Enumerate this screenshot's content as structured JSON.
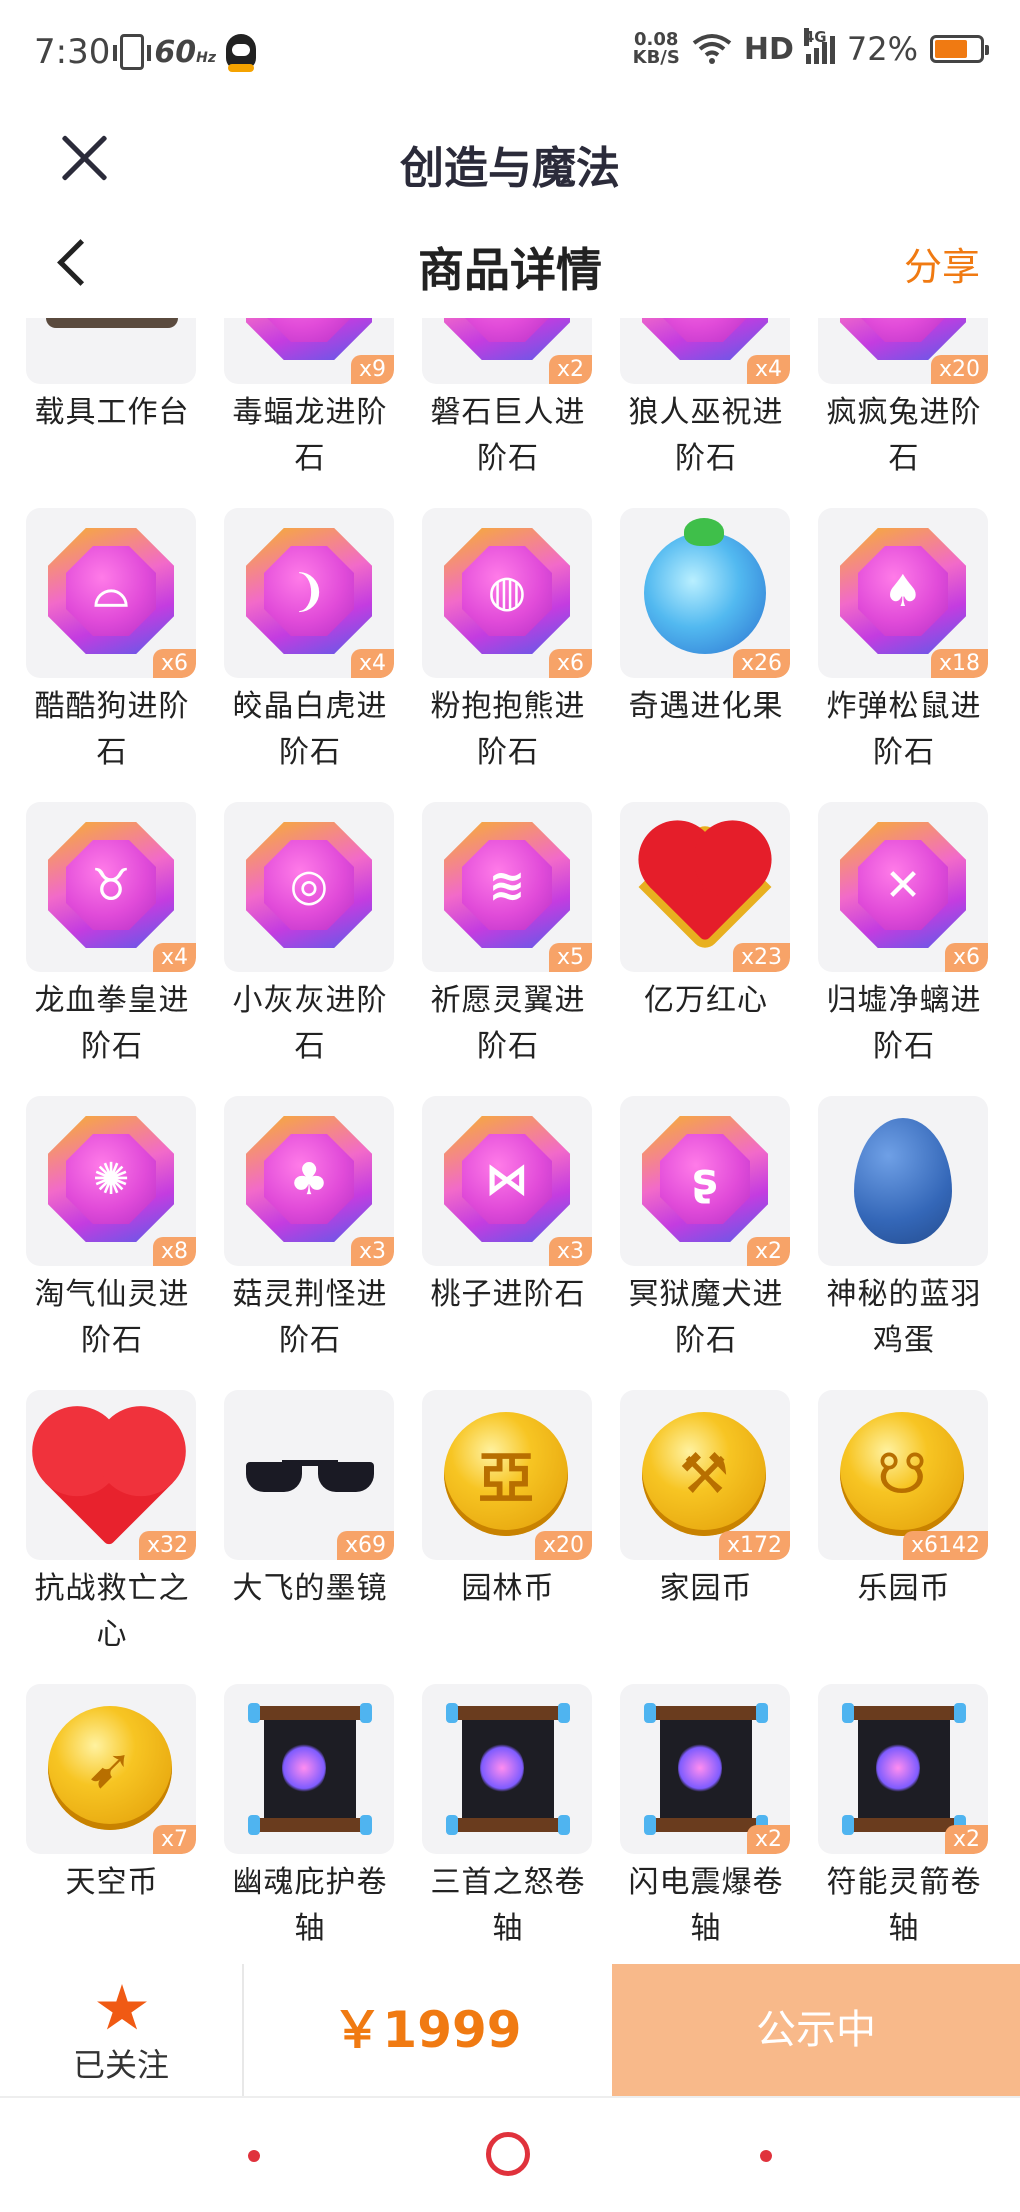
{
  "status_bar": {
    "time": "7:30",
    "refresh_rate": "60",
    "refresh_unit": "Hz",
    "net_speed_value": "0.08",
    "net_speed_unit": "KB/S",
    "hd": "HD",
    "network": "4G",
    "battery": "72%",
    "battery_level": 0.72
  },
  "app": {
    "title": "创造与魔法"
  },
  "header": {
    "title": "商品详情",
    "share": "分享"
  },
  "items": [
    {
      "name": "载具工作台",
      "count": "",
      "art": "vehicle"
    },
    {
      "name": "毒蝠龙进阶石",
      "count": "x9",
      "art": "gem",
      "glyph": "☠"
    },
    {
      "name": "磐石巨人进阶石",
      "count": "x2",
      "art": "gem",
      "glyph": "✦"
    },
    {
      "name": "狼人巫祝进阶石",
      "count": "x4",
      "art": "gem",
      "glyph": "♆"
    },
    {
      "name": "疯疯兔进阶石",
      "count": "x20",
      "art": "gem",
      "glyph": "♥"
    },
    {
      "name": "酷酷狗进阶石",
      "count": "x6",
      "art": "gem",
      "glyph": "⌓"
    },
    {
      "name": "皎晶白虎进阶石",
      "count": "x4",
      "art": "gem",
      "glyph": "❩"
    },
    {
      "name": "粉抱抱熊进阶石",
      "count": "x6",
      "art": "gem",
      "glyph": "◍"
    },
    {
      "name": "奇遇进化果",
      "count": "x26",
      "art": "berry"
    },
    {
      "name": "炸弹松鼠进阶石",
      "count": "x18",
      "art": "gem",
      "glyph": "♠"
    },
    {
      "name": "龙血拳皇进阶石",
      "count": "x4",
      "art": "gem",
      "glyph": "♉"
    },
    {
      "name": "小灰灰进阶石",
      "count": "",
      "art": "gem",
      "glyph": "◎"
    },
    {
      "name": "祈愿灵翼进阶石",
      "count": "x5",
      "art": "gem",
      "glyph": "≋"
    },
    {
      "name": "亿万红心",
      "count": "x23",
      "art": "heart"
    },
    {
      "name": "归墟净螭进阶石",
      "count": "x6",
      "art": "gem",
      "glyph": "✕"
    },
    {
      "name": "淘气仙灵进阶石",
      "count": "x8",
      "art": "gem",
      "glyph": "✺"
    },
    {
      "name": "菇灵荆怪进阶石",
      "count": "x3",
      "art": "gem",
      "glyph": "♣"
    },
    {
      "name": "桃子进阶石",
      "count": "x3",
      "art": "gem",
      "glyph": "⋈"
    },
    {
      "name": "冥狱魔犬进阶石",
      "count": "x2",
      "art": "gem",
      "glyph": "ʂ"
    },
    {
      "name": "神秘的蓝羽鸡蛋",
      "count": "",
      "art": "egg"
    },
    {
      "name": "抗战救亡之心",
      "count": "x32",
      "art": "heart-big"
    },
    {
      "name": "大飞的墨镜",
      "count": "x69",
      "art": "glasses"
    },
    {
      "name": "园林币",
      "count": "x20",
      "art": "coin",
      "glyph": "亞"
    },
    {
      "name": "家园币",
      "count": "x172",
      "art": "coin",
      "glyph": "⚒"
    },
    {
      "name": "乐园币",
      "count": "x6142",
      "art": "coin",
      "glyph": "☋"
    },
    {
      "name": "天空币",
      "count": "x7",
      "art": "coin",
      "glyph": "➹"
    },
    {
      "name": "幽魂庇护卷轴",
      "count": "",
      "art": "scroll"
    },
    {
      "name": "三首之怒卷轴",
      "count": "",
      "art": "scroll"
    },
    {
      "name": "闪电震爆卷轴",
      "count": "x2",
      "art": "scroll"
    },
    {
      "name": "符能灵箭卷轴",
      "count": "x2",
      "art": "scroll"
    }
  ],
  "bottom_bar": {
    "follow_label": "已关注",
    "price": "￥1999",
    "status_button": "公示中"
  },
  "colors": {
    "accent": "#f07a12",
    "badge": "#f7a368",
    "status_button_bg": "#f8b98a",
    "star": "#f05a14",
    "nav": "#e0323c"
  }
}
